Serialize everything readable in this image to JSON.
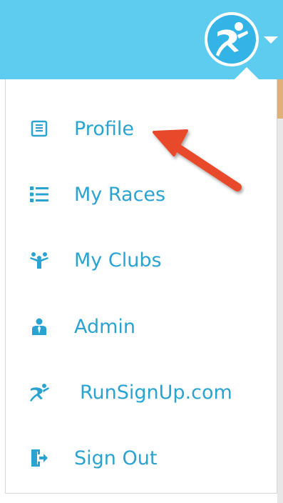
{
  "menu": {
    "items": [
      {
        "label": "Profile",
        "icon": "profile-icon"
      },
      {
        "label": "My Races",
        "icon": "list-icon"
      },
      {
        "label": "My Clubs",
        "icon": "clubs-icon"
      },
      {
        "label": "Admin",
        "icon": "admin-icon"
      },
      {
        "label": "RunSignUp.com",
        "icon": "runner-icon"
      },
      {
        "label": "Sign Out",
        "icon": "sign-out-icon"
      }
    ]
  },
  "colors": {
    "header": "#5dccef",
    "accent_text": "#2ba3d1",
    "annotation_arrow": "#e84a2a"
  }
}
